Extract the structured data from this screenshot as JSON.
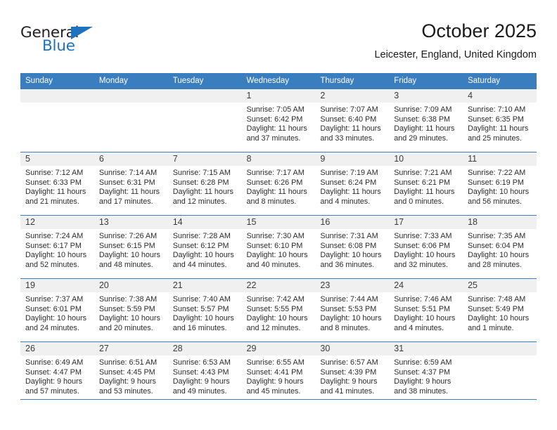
{
  "brand": {
    "word1": "General",
    "word2": "Blue",
    "accent_color": "#1f72bd"
  },
  "header": {
    "title": "October 2025",
    "subtitle": "Leicester, England, United Kingdom"
  },
  "theme": {
    "header_bar_color": "#3a7ebf",
    "daynum_band_color": "#f0f0f0"
  },
  "calendar": {
    "weekday_headers": [
      "Sunday",
      "Monday",
      "Tuesday",
      "Wednesday",
      "Thursday",
      "Friday",
      "Saturday"
    ],
    "weeks": [
      [
        {
          "day": "",
          "blank": true
        },
        {
          "day": "",
          "blank": true
        },
        {
          "day": "",
          "blank": true
        },
        {
          "day": "1",
          "sunrise": "Sunrise: 7:05 AM",
          "sunset": "Sunset: 6:42 PM",
          "daylight": "Daylight: 11 hours and 37 minutes."
        },
        {
          "day": "2",
          "sunrise": "Sunrise: 7:07 AM",
          "sunset": "Sunset: 6:40 PM",
          "daylight": "Daylight: 11 hours and 33 minutes."
        },
        {
          "day": "3",
          "sunrise": "Sunrise: 7:09 AM",
          "sunset": "Sunset: 6:38 PM",
          "daylight": "Daylight: 11 hours and 29 minutes."
        },
        {
          "day": "4",
          "sunrise": "Sunrise: 7:10 AM",
          "sunset": "Sunset: 6:35 PM",
          "daylight": "Daylight: 11 hours and 25 minutes."
        }
      ],
      [
        {
          "day": "5",
          "sunrise": "Sunrise: 7:12 AM",
          "sunset": "Sunset: 6:33 PM",
          "daylight": "Daylight: 11 hours and 21 minutes."
        },
        {
          "day": "6",
          "sunrise": "Sunrise: 7:14 AM",
          "sunset": "Sunset: 6:31 PM",
          "daylight": "Daylight: 11 hours and 17 minutes."
        },
        {
          "day": "7",
          "sunrise": "Sunrise: 7:15 AM",
          "sunset": "Sunset: 6:28 PM",
          "daylight": "Daylight: 11 hours and 12 minutes."
        },
        {
          "day": "8",
          "sunrise": "Sunrise: 7:17 AM",
          "sunset": "Sunset: 6:26 PM",
          "daylight": "Daylight: 11 hours and 8 minutes."
        },
        {
          "day": "9",
          "sunrise": "Sunrise: 7:19 AM",
          "sunset": "Sunset: 6:24 PM",
          "daylight": "Daylight: 11 hours and 4 minutes."
        },
        {
          "day": "10",
          "sunrise": "Sunrise: 7:21 AM",
          "sunset": "Sunset: 6:21 PM",
          "daylight": "Daylight: 11 hours and 0 minutes."
        },
        {
          "day": "11",
          "sunrise": "Sunrise: 7:22 AM",
          "sunset": "Sunset: 6:19 PM",
          "daylight": "Daylight: 10 hours and 56 minutes."
        }
      ],
      [
        {
          "day": "12",
          "sunrise": "Sunrise: 7:24 AM",
          "sunset": "Sunset: 6:17 PM",
          "daylight": "Daylight: 10 hours and 52 minutes."
        },
        {
          "day": "13",
          "sunrise": "Sunrise: 7:26 AM",
          "sunset": "Sunset: 6:15 PM",
          "daylight": "Daylight: 10 hours and 48 minutes."
        },
        {
          "day": "14",
          "sunrise": "Sunrise: 7:28 AM",
          "sunset": "Sunset: 6:12 PM",
          "daylight": "Daylight: 10 hours and 44 minutes."
        },
        {
          "day": "15",
          "sunrise": "Sunrise: 7:30 AM",
          "sunset": "Sunset: 6:10 PM",
          "daylight": "Daylight: 10 hours and 40 minutes."
        },
        {
          "day": "16",
          "sunrise": "Sunrise: 7:31 AM",
          "sunset": "Sunset: 6:08 PM",
          "daylight": "Daylight: 10 hours and 36 minutes."
        },
        {
          "day": "17",
          "sunrise": "Sunrise: 7:33 AM",
          "sunset": "Sunset: 6:06 PM",
          "daylight": "Daylight: 10 hours and 32 minutes."
        },
        {
          "day": "18",
          "sunrise": "Sunrise: 7:35 AM",
          "sunset": "Sunset: 6:04 PM",
          "daylight": "Daylight: 10 hours and 28 minutes."
        }
      ],
      [
        {
          "day": "19",
          "sunrise": "Sunrise: 7:37 AM",
          "sunset": "Sunset: 6:01 PM",
          "daylight": "Daylight: 10 hours and 24 minutes."
        },
        {
          "day": "20",
          "sunrise": "Sunrise: 7:38 AM",
          "sunset": "Sunset: 5:59 PM",
          "daylight": "Daylight: 10 hours and 20 minutes."
        },
        {
          "day": "21",
          "sunrise": "Sunrise: 7:40 AM",
          "sunset": "Sunset: 5:57 PM",
          "daylight": "Daylight: 10 hours and 16 minutes."
        },
        {
          "day": "22",
          "sunrise": "Sunrise: 7:42 AM",
          "sunset": "Sunset: 5:55 PM",
          "daylight": "Daylight: 10 hours and 12 minutes."
        },
        {
          "day": "23",
          "sunrise": "Sunrise: 7:44 AM",
          "sunset": "Sunset: 5:53 PM",
          "daylight": "Daylight: 10 hours and 8 minutes."
        },
        {
          "day": "24",
          "sunrise": "Sunrise: 7:46 AM",
          "sunset": "Sunset: 5:51 PM",
          "daylight": "Daylight: 10 hours and 4 minutes."
        },
        {
          "day": "25",
          "sunrise": "Sunrise: 7:48 AM",
          "sunset": "Sunset: 5:49 PM",
          "daylight": "Daylight: 10 hours and 1 minute."
        }
      ],
      [
        {
          "day": "26",
          "sunrise": "Sunrise: 6:49 AM",
          "sunset": "Sunset: 4:47 PM",
          "daylight": "Daylight: 9 hours and 57 minutes."
        },
        {
          "day": "27",
          "sunrise": "Sunrise: 6:51 AM",
          "sunset": "Sunset: 4:45 PM",
          "daylight": "Daylight: 9 hours and 53 minutes."
        },
        {
          "day": "28",
          "sunrise": "Sunrise: 6:53 AM",
          "sunset": "Sunset: 4:43 PM",
          "daylight": "Daylight: 9 hours and 49 minutes."
        },
        {
          "day": "29",
          "sunrise": "Sunrise: 6:55 AM",
          "sunset": "Sunset: 4:41 PM",
          "daylight": "Daylight: 9 hours and 45 minutes."
        },
        {
          "day": "30",
          "sunrise": "Sunrise: 6:57 AM",
          "sunset": "Sunset: 4:39 PM",
          "daylight": "Daylight: 9 hours and 41 minutes."
        },
        {
          "day": "31",
          "sunrise": "Sunrise: 6:59 AM",
          "sunset": "Sunset: 4:37 PM",
          "daylight": "Daylight: 9 hours and 38 minutes."
        },
        {
          "day": "",
          "blank": true
        }
      ]
    ]
  }
}
